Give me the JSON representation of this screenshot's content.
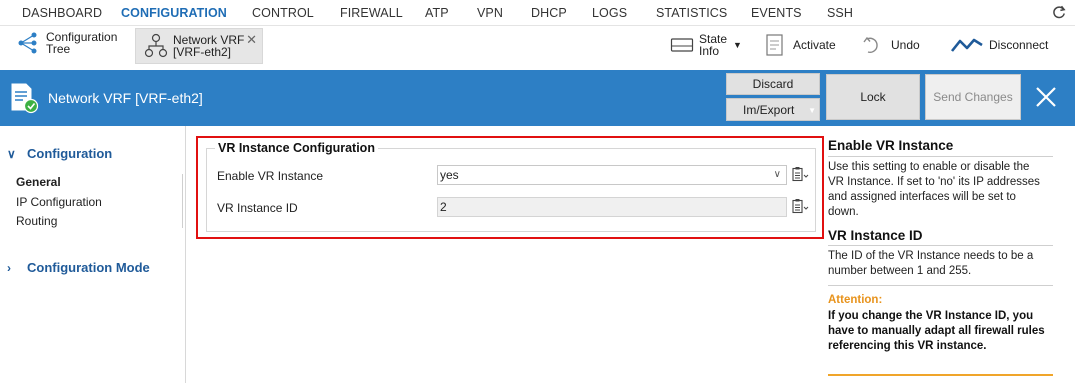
{
  "nav": {
    "items": [
      "DASHBOARD",
      "CONFIGURATION",
      "CONTROL",
      "FIREWALL",
      "ATP",
      "VPN",
      "DHCP",
      "LOGS",
      "STATISTICS",
      "EVENTS",
      "SSH"
    ],
    "active": "CONFIGURATION"
  },
  "toolbar": {
    "config_tree_label_1": "Configuration",
    "config_tree_label_2": "Tree",
    "tab_label_1": "Network VRF",
    "tab_label_2": "[VRF-eth2]",
    "tab_close": "✕",
    "state_info_1": "State",
    "state_info_2": "Info",
    "activate": "Activate",
    "undo": "Undo",
    "disconnect": "Disconnect"
  },
  "header": {
    "title": "Network VRF [VRF-eth2]",
    "discard": "Discard",
    "im_export": "Im/Export",
    "lock": "Lock",
    "send_changes": "Send Changes"
  },
  "sidebar": {
    "configuration": "Configuration",
    "items": [
      "General",
      "IP Configuration",
      "Routing"
    ],
    "active_item": "General",
    "configuration_mode": "Configuration Mode"
  },
  "form": {
    "section_title": "VR Instance Configuration",
    "enable_label": "Enable VR Instance",
    "enable_value": "yes",
    "id_label": "VR Instance ID",
    "id_value": "2"
  },
  "help": {
    "enable_title": "Enable VR Instance",
    "enable_text": "Use this setting to enable or disable the VR Instance. If set to 'no' its IP addresses and assigned interfaces will be set to down.",
    "id_title": "VR Instance ID",
    "id_text": "The ID of the VR Instance needs to be a number between 1 and 255.",
    "attention_label": "Attention:",
    "attention_text": "If you change the VR Instance ID, you have to manually adapt all firewall rules referencing this VR instance."
  },
  "colors": {
    "header_blue": "#2d7fc5",
    "nav_active": "#1f6db5",
    "highlight_red": "#e11010",
    "attention_orange": "#e8931c"
  }
}
